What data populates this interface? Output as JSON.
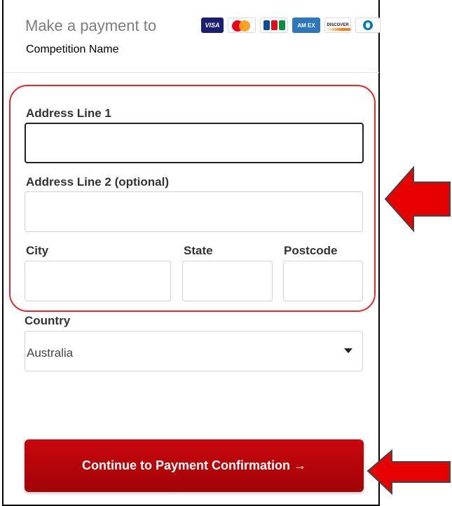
{
  "header": {
    "make_payment_text": "Make a payment to",
    "competition_name": "Competition Name",
    "card_icons": [
      "visa-icon",
      "mastercard-icon",
      "jcb-icon",
      "amex-icon",
      "discover-icon",
      "diners-icon"
    ],
    "card_labels": {
      "visa": "VISA",
      "amex": "AM EX",
      "discover": "DISCOVER"
    }
  },
  "form": {
    "address1": {
      "label": "Address Line 1",
      "value": ""
    },
    "address2": {
      "label": "Address Line 2 (optional)",
      "value": ""
    },
    "city": {
      "label": "City",
      "value": ""
    },
    "state": {
      "label": "State",
      "value": ""
    },
    "postcode": {
      "label": "Postcode",
      "value": ""
    },
    "country": {
      "label": "Country",
      "selected": "Australia"
    }
  },
  "continue_button": {
    "label": "Continue to Payment Confirmation →"
  },
  "annotations": {
    "highlight_color": "#e8262b",
    "arrow_color": "#e60000",
    "primary_button_color": "#b8050b"
  }
}
